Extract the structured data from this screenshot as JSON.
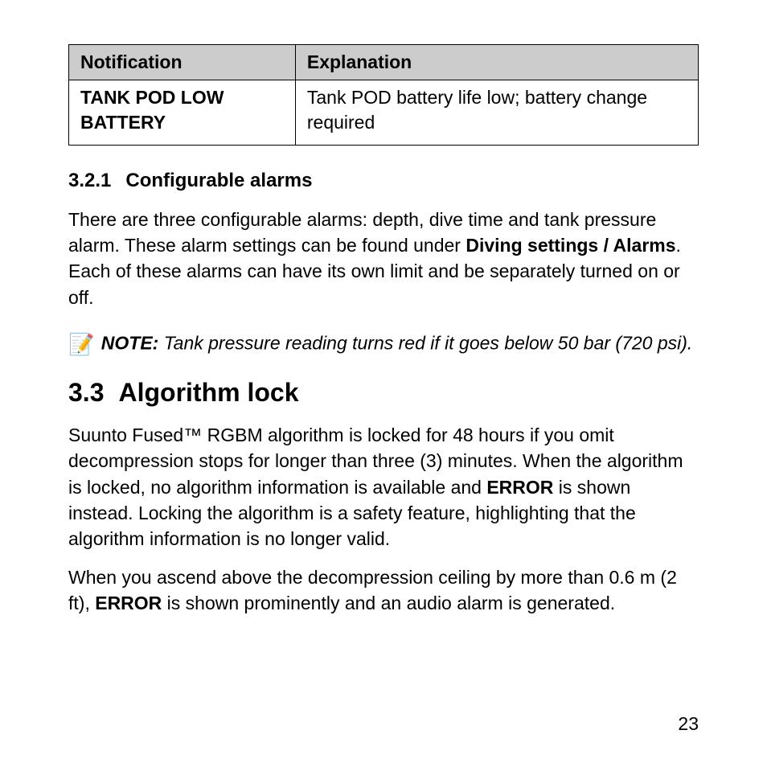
{
  "table": {
    "headers": [
      "Notification",
      "Explanation"
    ],
    "row": {
      "notification": "TANK POD LOW BATTERY",
      "explanation": "Tank POD battery life low; battery change required"
    }
  },
  "sub": {
    "num": "3.2.1",
    "title": "Configurable alarms",
    "para_a": "There are three configurable alarms: depth, dive time and tank pressure alarm. These alarm settings can be found under ",
    "para_b_bold": "Diving settings / Alarms",
    "para_c": ". Each of these alarms can have its own limit and be separately turned on or off."
  },
  "note": {
    "icon": "📝",
    "label": "NOTE:",
    "text": " Tank pressure reading turns red if it goes below 50 bar (720 psi)."
  },
  "section": {
    "num": "3.3",
    "title": "Algorithm lock",
    "p1_a": "Suunto Fused™ RGBM algorithm is locked for 48 hours if you omit decompression stops for longer than three (3) minutes. When the algorithm is locked, no algorithm information is available and ",
    "p1_b_bold": "ERROR",
    "p1_c": " is shown instead. Locking the algorithm is a safety feature, highlighting that the algorithm information is no longer valid.",
    "p2_a": "When you ascend above the decompression ceiling by more than 0.6 m (2 ft), ",
    "p2_b_bold": "ERROR",
    "p2_c": " is shown prominently and an audio alarm is generated."
  },
  "page_number": "23"
}
